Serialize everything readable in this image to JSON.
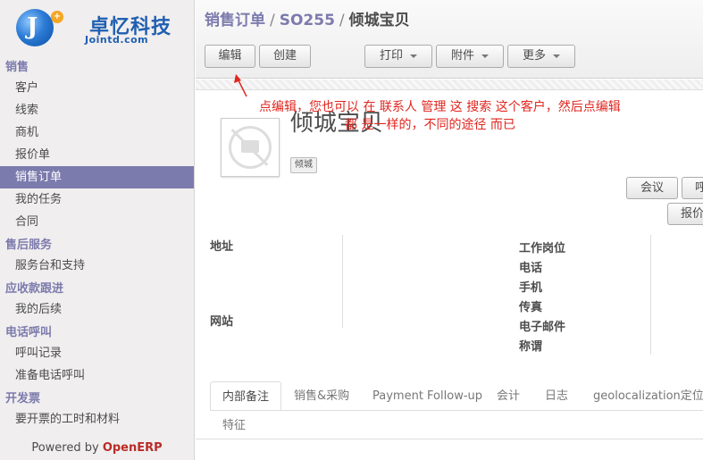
{
  "logo": {
    "mark_letter": "J",
    "mark_badge": "+",
    "name_cn": "卓忆科技",
    "name_en": "Jointd.com"
  },
  "sidebar": {
    "sections": [
      {
        "title": "销售",
        "items": [
          "客户",
          "线索",
          "商机",
          "报价单",
          "销售订单",
          "我的任务",
          "合同"
        ]
      },
      {
        "title": "售后服务",
        "items": [
          "服务台和支持"
        ]
      },
      {
        "title": "应收款跟进",
        "items": [
          "我的后续"
        ]
      },
      {
        "title": "电话呼叫",
        "items": [
          "呼叫记录",
          "准备电话呼叫"
        ]
      },
      {
        "title": "开发票",
        "items": [
          "要开票的工时和材料"
        ]
      }
    ],
    "active_item": "销售订单",
    "powered_prefix": "Powered by ",
    "powered_brand": "OpenERP"
  },
  "breadcrumb": {
    "root": "销售订单",
    "sep": "/",
    "order": "SO255",
    "current": "倾城宝贝"
  },
  "toolbar": {
    "edit": "编辑",
    "create": "创建",
    "print": "打印",
    "attach": "附件",
    "more": "更多"
  },
  "partner": {
    "name": "倾城宝贝",
    "tag": "倾城"
  },
  "smart_buttons": {
    "meeting": "会议",
    "call": "呼",
    "quote": "报价"
  },
  "fields": {
    "address": "地址",
    "website": "网站",
    "job": "工作岗位",
    "phone": "电话",
    "mobile": "手机",
    "fax": "传真",
    "email": "电子邮件",
    "title": "称谓"
  },
  "tabs": [
    "内部备注",
    "销售&采购",
    "Payment Follow-up",
    "会计",
    "日志",
    "geolocalization定位",
    "特征"
  ],
  "annotation": {
    "line1": "点编辑，您也可以 在  联系人 管理 这 搜索 这个客户，然后点编辑",
    "line2": "都 是一样的，不同的途径 而已"
  },
  "colors": {
    "accent": "#7c7bad",
    "annotation": "#e0261f",
    "brand": "#b92c28"
  }
}
